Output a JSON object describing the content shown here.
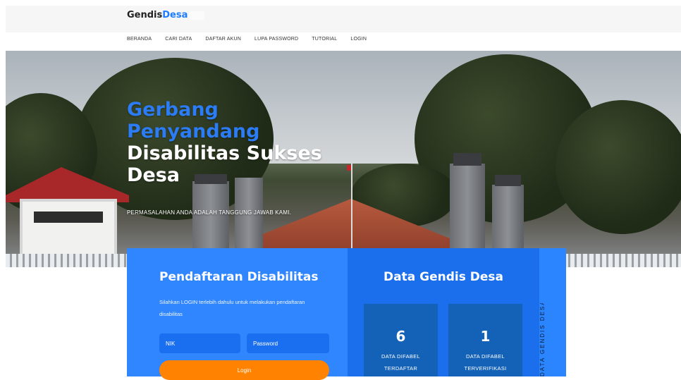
{
  "brand": {
    "name_part1": "Gendis",
    "name_part2": "Desa"
  },
  "nav": {
    "items": [
      "BERANDA",
      "CARI DATA",
      "DAFTAR AKUN",
      "LUPA PASSWORD",
      "TUTORIAL",
      "LOGIN"
    ]
  },
  "hero": {
    "title_line1": "Gerbang",
    "title_line2": "Penyandang",
    "title_line3": "Disabilitas Sukses",
    "title_line4": "Desa",
    "subtitle": "PERMASALAHAN ANDA ADALAH TANGGUNG JAWAB KAMI."
  },
  "registration": {
    "title": "Pendaftaran Disabilitas",
    "description": "Silahkan LOGIN terlebih dahulu untuk melakukan pendaftaran disabilitas",
    "nik_placeholder": "NIK",
    "password_placeholder": "Password",
    "login_label": "Login"
  },
  "stats": {
    "title": "Data Gendis Desa",
    "items": [
      {
        "value": "6",
        "label_line1": "DATA DIFABEL",
        "label_line2": "TERDAFTAR"
      },
      {
        "value": "1",
        "label_line1": "DATA DIFABEL",
        "label_line2": "TERVERIFIKASI"
      }
    ],
    "vertical_label": "DATA GENDIS DESA"
  },
  "colors": {
    "accent": "#2f86ff",
    "button": "#ff8200",
    "stat_card": "#1362b8"
  }
}
